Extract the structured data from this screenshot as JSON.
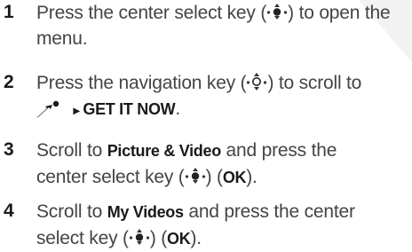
{
  "steps": [
    {
      "number": "1",
      "pre": "Press the center select key (",
      "post": ") to open the menu."
    },
    {
      "number": "2",
      "pre": "Press the navigation key (",
      "mid": ") to scroll to",
      "arrow": "▸",
      "menu_item": "GET IT NOW",
      "end": "."
    },
    {
      "number": "3",
      "pre": "Scroll to ",
      "target": "Picture & Video",
      "mid": " and press the center select key (",
      "after_key": ") (",
      "ok": "OK",
      "end": ")."
    },
    {
      "number": "4",
      "pre": "Scroll to ",
      "target": "My Videos",
      "mid": " and press the center select key (",
      "after_key": ") (",
      "ok": "OK",
      "end": ")."
    }
  ],
  "icons": {
    "select_key": "center-select-key-icon",
    "nav_key": "navigation-key-icon",
    "get_it_now": "get-it-now-icon"
  }
}
